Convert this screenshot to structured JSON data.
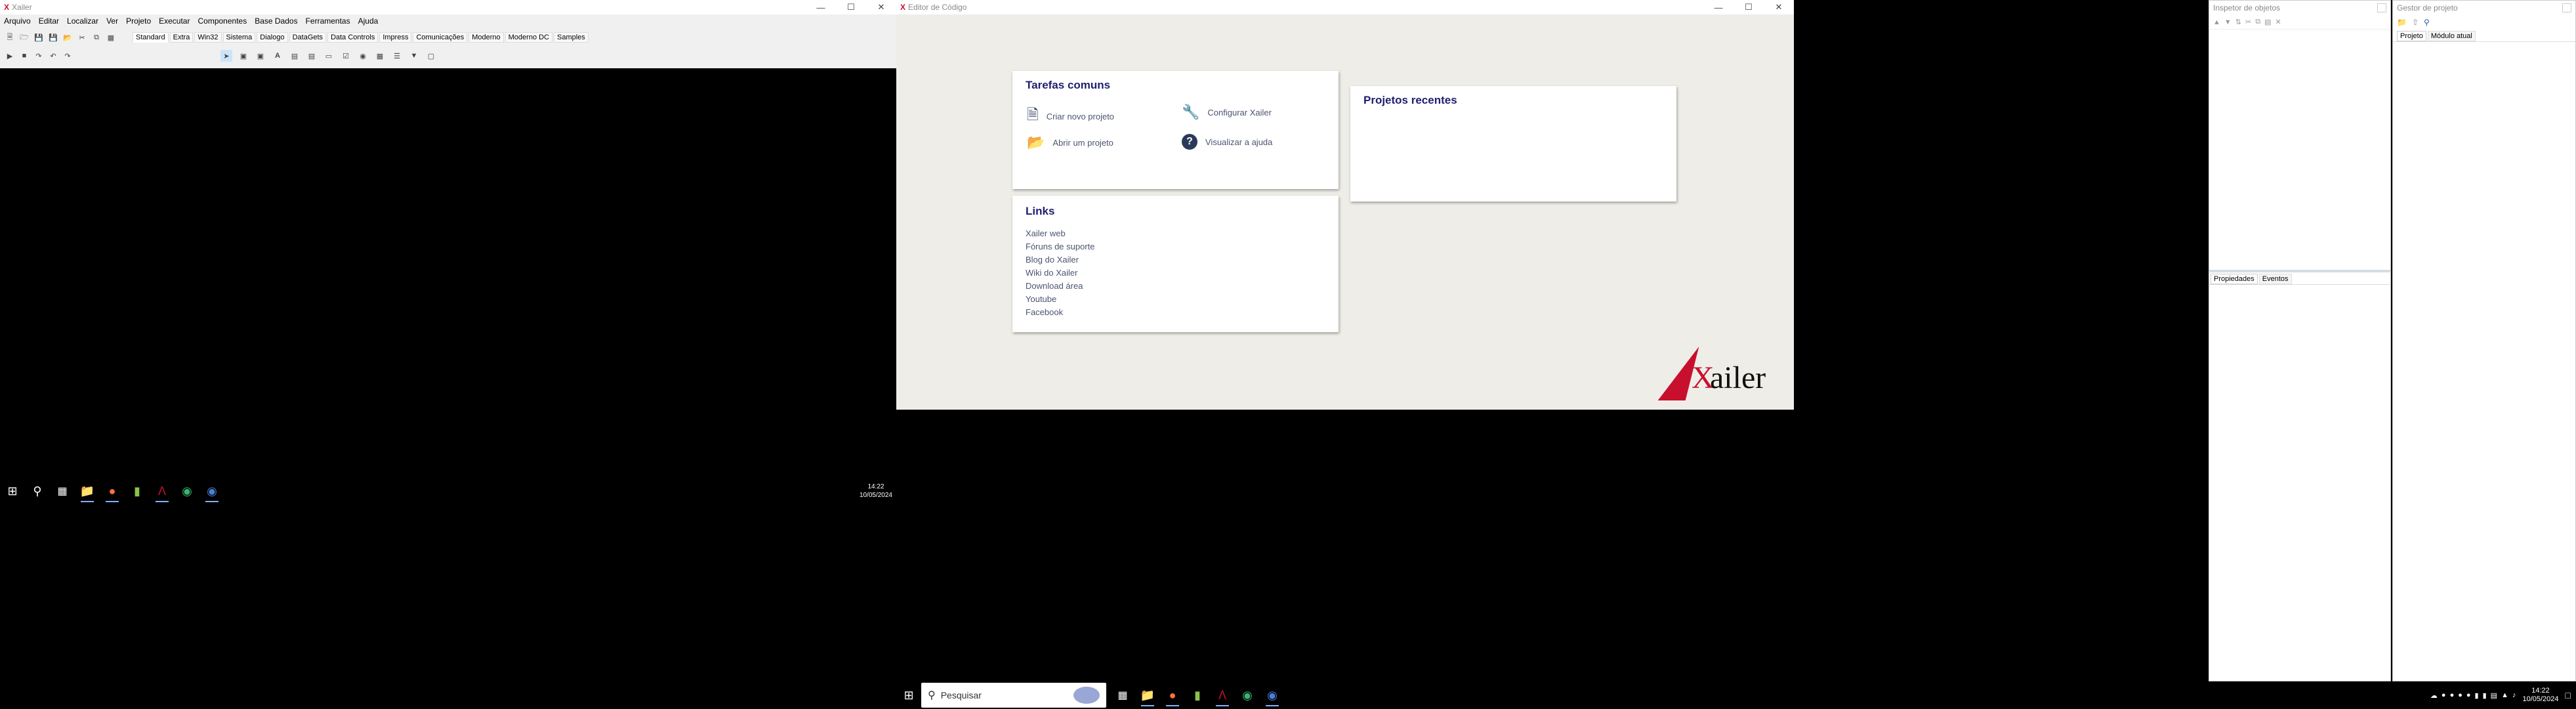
{
  "xailer_main": {
    "title": "Xailer",
    "menu": [
      "Arquivo",
      "Editar",
      "Localizar",
      "Ver",
      "Projeto",
      "Executar",
      "Componentes",
      "Base Dados",
      "Ferramentas",
      "Ajuda"
    ],
    "palette_tabs": [
      "Standard",
      "Extra",
      "Win32",
      "Sistema",
      "Dialogo",
      "DataGets",
      "Data Controls",
      "Impress",
      "Comunicações",
      "Moderno",
      "Moderno DC",
      "Samples"
    ]
  },
  "left_taskbar": {
    "time": "14:22",
    "date": "10/05/2024"
  },
  "code_editor": {
    "title": "Editor de Código",
    "common_tasks": {
      "title": "Tarefas comuns",
      "new_project": "Criar novo projeto",
      "open_project": "Abrir um projeto",
      "configure": "Configurar Xailer",
      "help": "Visualizar a ajuda"
    },
    "recent": {
      "title": "Projetos recentes"
    },
    "links": {
      "title": "Links",
      "items": [
        "Xailer web",
        "Fóruns de suporte",
        "Blog do Xailer",
        "Wiki do Xailer",
        "Download área",
        "Youtube",
        "Facebook"
      ]
    },
    "logo_text": "ailer",
    "logo_x": "X"
  },
  "inspector": {
    "title": "Inspetor de objetos",
    "tab_properties": "Propiedades",
    "tab_events": "Eventos"
  },
  "project_manager": {
    "title": "Gestor de projeto",
    "tab_project": "Projeto",
    "tab_module": "Módulo atual"
  },
  "main_taskbar": {
    "search_placeholder": "Pesquisar",
    "time": "14:22",
    "date": "10/05/2024"
  },
  "colors": {
    "accent": "#1f1f6e",
    "logo_red": "#c8102e",
    "taskbar": "#000000"
  }
}
